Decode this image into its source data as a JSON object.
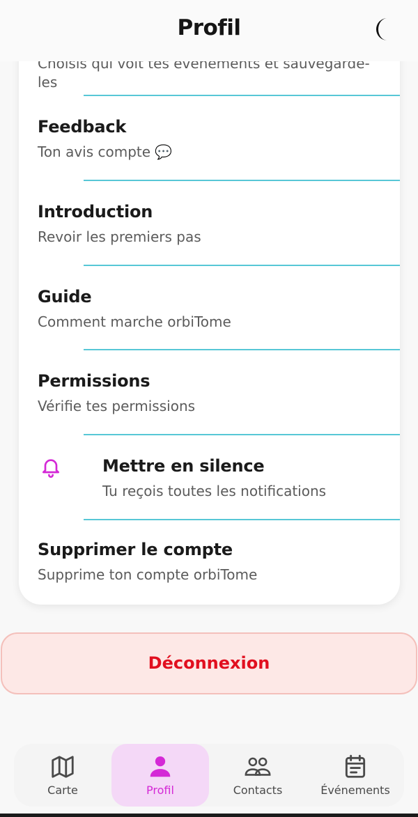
{
  "header": {
    "title": "Profil",
    "theme_icon": "moon-icon"
  },
  "settings": {
    "partial_item": {
      "subtitle": "Choisis qui voit tes événements et sauvegarde-les"
    },
    "items": [
      {
        "title": "Feedback",
        "subtitle": "Ton avis compte 💬"
      },
      {
        "title": "Introduction",
        "subtitle": "Revoir les premiers pas"
      },
      {
        "title": "Guide",
        "subtitle": "Comment marche orbiTome"
      },
      {
        "title": "Permissions",
        "subtitle": "Vérifie tes permissions"
      },
      {
        "title": "Mettre en silence",
        "subtitle": "Tu reçois toutes les notifications",
        "icon": "bell-icon"
      },
      {
        "title": "Supprimer le compte",
        "subtitle": "Supprime ton compte orbiTome"
      }
    ]
  },
  "logout": {
    "label": "Déconnexion"
  },
  "nav": {
    "items": [
      {
        "label": "Carte",
        "icon": "map-icon",
        "active": false
      },
      {
        "label": "Profil",
        "icon": "person-icon",
        "active": true
      },
      {
        "label": "Contacts",
        "icon": "contacts-icon",
        "active": false
      },
      {
        "label": "Événements",
        "icon": "calendar-icon",
        "active": false
      }
    ]
  },
  "colors": {
    "accent": "#d429d6",
    "divider": "#57c7d6",
    "danger": "#e10f1f",
    "danger_bg": "#fde8e6"
  }
}
